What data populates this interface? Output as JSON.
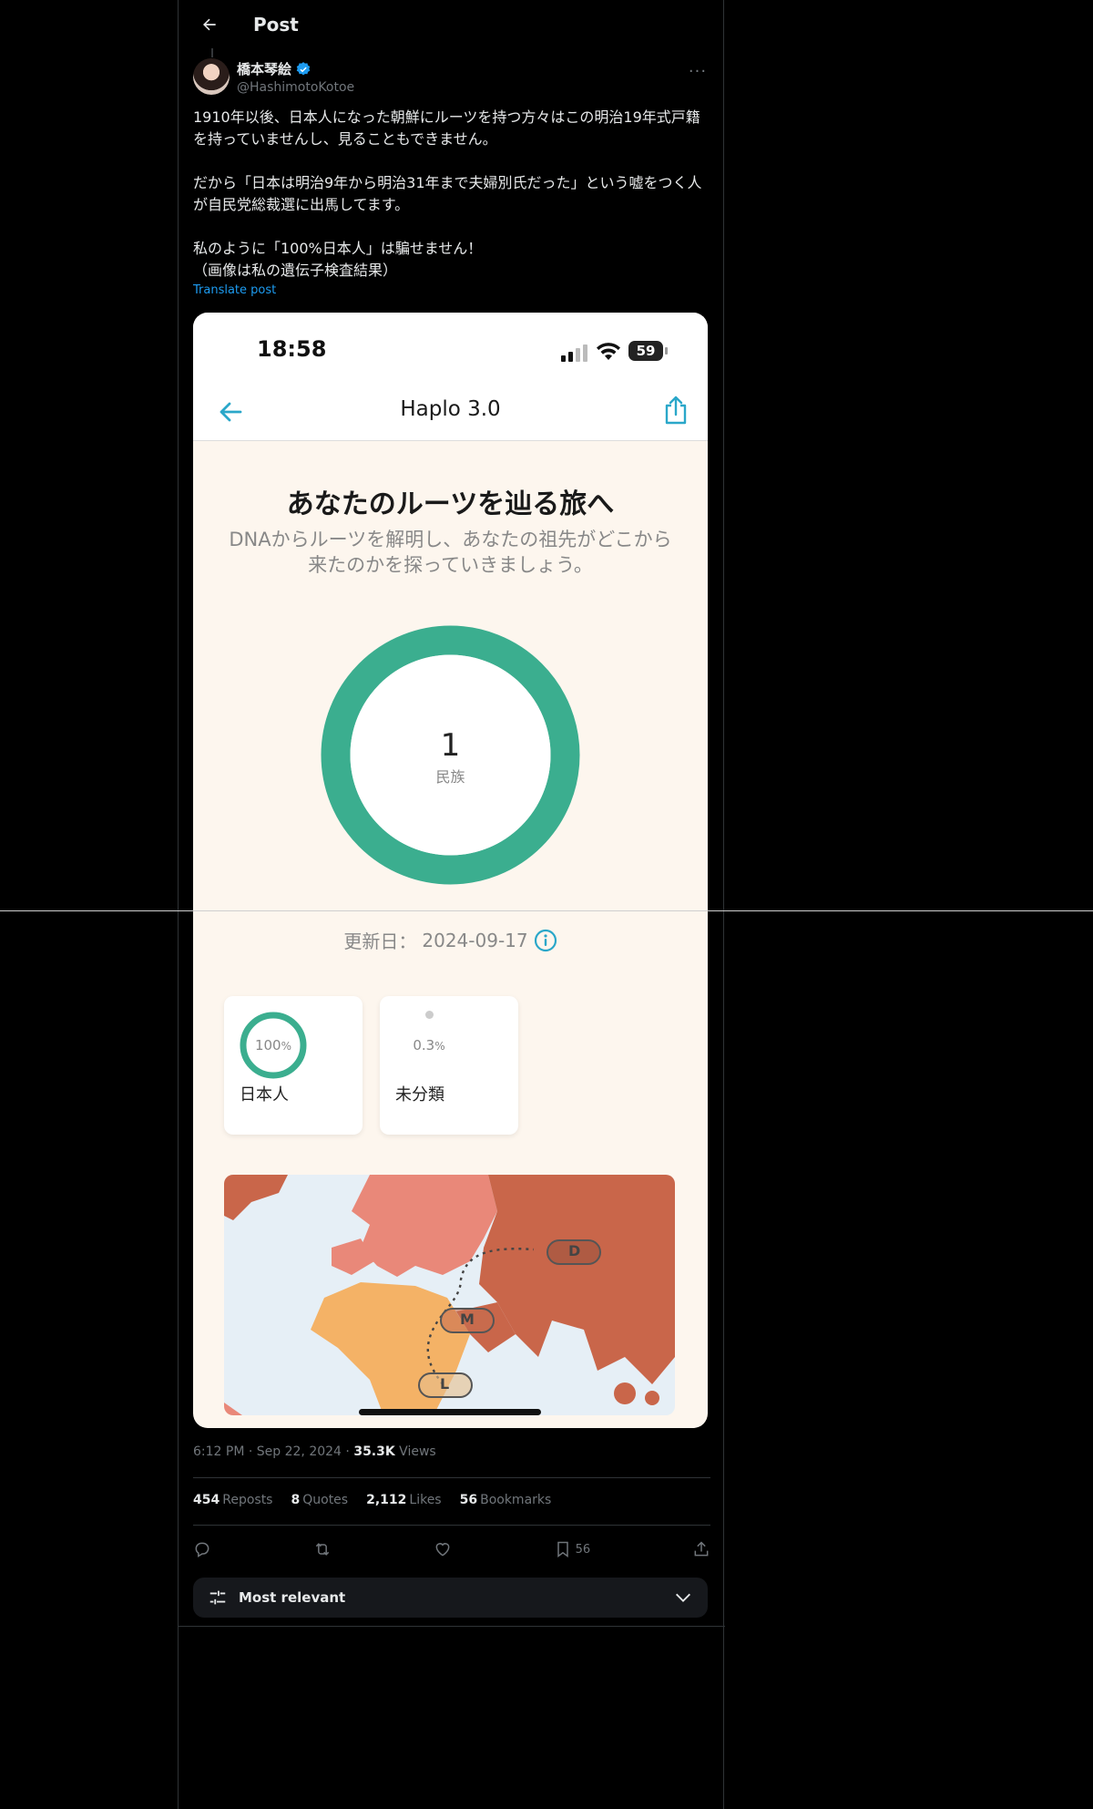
{
  "header": {
    "title": "Post"
  },
  "author": {
    "display_name": "橋本琴絵",
    "handle": "@HashimotoKotoe"
  },
  "post": {
    "text": "1910年以後、日本人になった朝鮮にルーツを持つ方々はこの明治19年式戸籍を持っていませんし、見ることもできません。\n\nだから「日本は明治9年から明治31年まで夫婦別氏だった」という嘘をつく人が自民党総裁選に出馬してます。\n\n私のように「100%日本人」は騙せません！\n（画像は私の遺伝子検査結果）",
    "translate_label": "Translate post"
  },
  "media": {
    "phone_time": "18:58",
    "battery": "59",
    "app_title": "Haplo 3.0",
    "hero_title": "あなたのルーツを辿る旅へ",
    "hero_subtitle": "DNAからルーツを解明し、あなたの祖先がどこから来たのかを探っていきましょう。",
    "donut_count": "1",
    "donut_label": "民族",
    "update_label": "更新日：",
    "update_date": "2024-09-17",
    "ethnicities": [
      {
        "percent": "100",
        "unit": "%",
        "name": "日本人",
        "fraction": 1.0
      },
      {
        "percent": "0.3",
        "unit": "%",
        "name": "未分類",
        "fraction": 0.003
      }
    ],
    "map_labels": {
      "d": "D",
      "m": "M",
      "l": "L"
    },
    "colors": {
      "teal": "#3bae8f",
      "africa": "#f4b266",
      "asia": "#c9664a",
      "europe": "#e98879",
      "ocean": "#e6eff6"
    }
  },
  "meta": {
    "time": "6:12 PM",
    "date": "Sep 22, 2024",
    "views_count": "35.3K",
    "views_label": "Views"
  },
  "stats": {
    "reposts_count": "454",
    "reposts_label": "Reposts",
    "quotes_count": "8",
    "quotes_label": "Quotes",
    "likes_count": "2,112",
    "likes_label": "Likes",
    "bookmarks_count": "56",
    "bookmarks_label": "Bookmarks"
  },
  "actions": {
    "bookmark_count": "56"
  },
  "sort": {
    "label": "Most relevant"
  }
}
